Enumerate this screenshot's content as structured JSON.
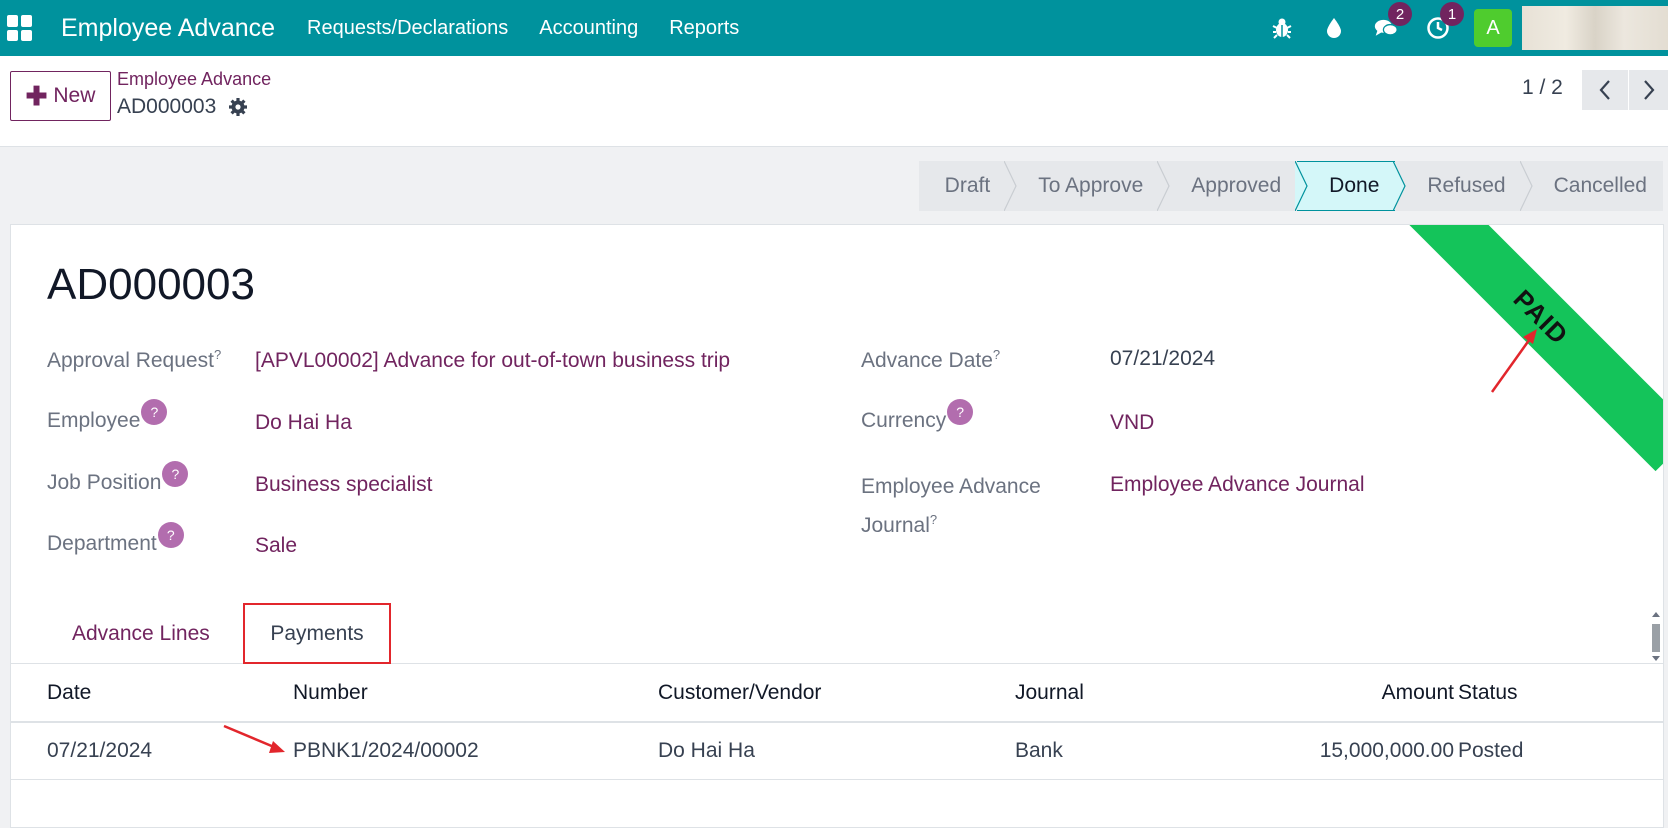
{
  "navbar": {
    "brand": "Employee Advance",
    "menus": [
      "Requests/Declarations",
      "Accounting",
      "Reports"
    ],
    "messages_badge": "2",
    "activity_badge": "1",
    "avatar_letter": "A",
    "bg_color": "#00929d"
  },
  "control": {
    "new_label": "New",
    "breadcrumb_parent": "Employee Advance",
    "breadcrumb_current": "AD000003",
    "pager": "1 / 2"
  },
  "statusbar": {
    "stages": [
      "Draft",
      "To Approve",
      "Approved",
      "Done",
      "Refused",
      "Cancelled"
    ],
    "active": "Done"
  },
  "record": {
    "title": "AD000003",
    "ribbon": "PAID",
    "ribbon_color": "#14c45a",
    "fields_left": {
      "approval_request_label": "Approval Request",
      "approval_request_value": "[APVL00002] Advance for out-of-town business trip",
      "employee_label": "Employee",
      "employee_value": "Do Hai Ha",
      "job_position_label": "Job Position",
      "job_position_value": "Business specialist",
      "department_label": "Department",
      "department_value": "Sale"
    },
    "fields_right": {
      "advance_date_label": "Advance Date",
      "advance_date_value": "07/21/2024",
      "currency_label": "Currency",
      "currency_value": "VND",
      "journal_label_1": "Employee Advance",
      "journal_label_2": "Journal",
      "journal_value": "Employee Advance Journal"
    },
    "help_mark": "?"
  },
  "tabs": {
    "advance_lines": "Advance Lines",
    "payments": "Payments"
  },
  "payments_table": {
    "headers": [
      "Date",
      "Number",
      "Customer/Vendor",
      "Journal",
      "Amount",
      "Status"
    ],
    "rows": [
      {
        "date": "07/21/2024",
        "number": "PBNK1/2024/00002",
        "partner": "Do Hai Ha",
        "journal": "Bank",
        "amount": "15,000,000.00",
        "status": "Posted"
      }
    ]
  }
}
